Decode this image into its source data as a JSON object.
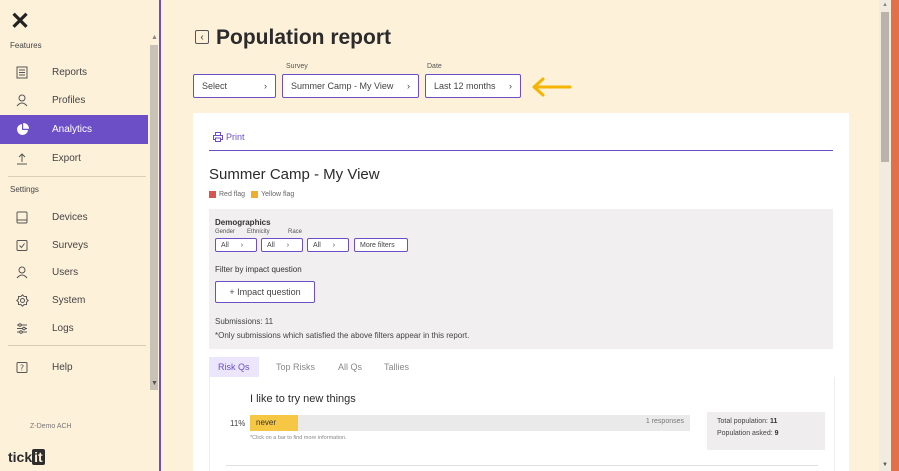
{
  "sidebar": {
    "close_icon": "close-icon",
    "features_label": "Features",
    "features": [
      {
        "label": "Reports",
        "icon": "reports-icon"
      },
      {
        "label": "Profiles",
        "icon": "profile-icon"
      },
      {
        "label": "Analytics",
        "icon": "pie-chart-icon",
        "active": true
      },
      {
        "label": "Export",
        "icon": "upload-icon"
      }
    ],
    "settings_label": "Settings",
    "settings": [
      {
        "label": "Devices",
        "icon": "tablet-icon"
      },
      {
        "label": "Surveys",
        "icon": "checkbox-icon"
      },
      {
        "label": "Users",
        "icon": "user-icon"
      },
      {
        "label": "System",
        "icon": "gear-icon"
      },
      {
        "label": "Logs",
        "icon": "sliders-icon"
      }
    ],
    "help": {
      "label": "Help",
      "icon": "help-icon"
    },
    "org_name": "Z-Demo ACH",
    "logo": {
      "text": "tick",
      "badge": "it"
    }
  },
  "header": {
    "title": "Population report",
    "selectors": {
      "first": {
        "value": "Select"
      },
      "survey": {
        "label": "Survey",
        "value": "Summer Camp - My View"
      },
      "date": {
        "label": "Date",
        "value": "Last 12 months"
      }
    }
  },
  "report": {
    "print_label": "Print",
    "title": "Summer Camp - My View",
    "legend": [
      {
        "label": "Red flag",
        "color": "#d9534f"
      },
      {
        "label": "Yellow flag",
        "color": "#f0ad2c"
      }
    ],
    "filters": {
      "heading": "Demographics",
      "gender_label": "Gender",
      "ethnicity_label": "Ethnicity",
      "race_label": "Race",
      "gender_value": "All",
      "ethnicity_value": "All",
      "race_value": "All",
      "more_filters": "More filters",
      "impact_heading": "Filter by impact question",
      "impact_button": "+ Impact question",
      "submissions": "Submissions: 11",
      "note": "*Only submissions which satisfied the above filters appear in this report."
    },
    "tabs": [
      "Risk Qs",
      "Top Risks",
      "All Qs",
      "Tallies"
    ],
    "active_tab": 0,
    "question": {
      "title": "I like to try new things",
      "percent_text": "11%",
      "percent_value": 11,
      "bar_label": "never",
      "responses": "1 responses",
      "hint": "*Click on a bar to find more information.",
      "total_population_label": "Total population:",
      "total_population": "11",
      "population_asked_label": "Population asked:",
      "population_asked": "9"
    }
  },
  "colors": {
    "accent": "#6c4fc7",
    "bar": "#f6c744",
    "arrow": "#f4b400",
    "background": "#fdf1da"
  }
}
